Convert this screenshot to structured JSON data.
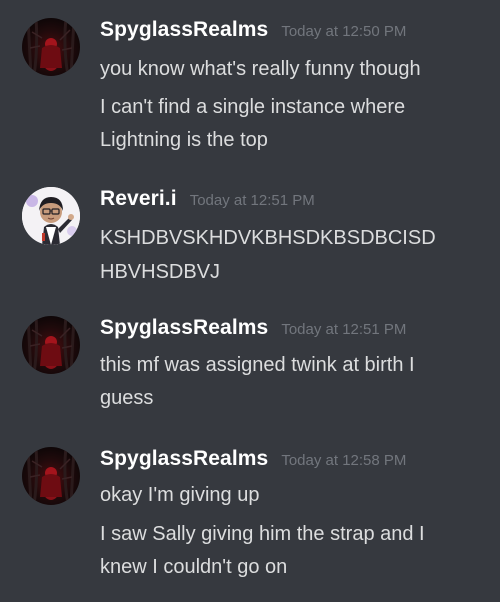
{
  "messages": [
    {
      "author": "SpyglassRealms",
      "timestamp": "Today at 12:50 PM",
      "avatar_icon": "dark-red-forest-avatar-icon",
      "lines": [
        "you know what's really funny though",
        "I can't find a single instance where",
        "Lightning is the top"
      ]
    },
    {
      "author": "Reveri.i",
      "timestamp": "Today at 12:51 PM",
      "avatar_icon": "chibi-character-avatar-icon",
      "lines": [
        "KSHDBVSKHDVKBHSDKBSDBCISD",
        "HBVHSDBVJ"
      ]
    },
    {
      "author": "SpyglassRealms",
      "timestamp": "Today at 12:51 PM",
      "avatar_icon": "dark-red-forest-avatar-icon",
      "lines": [
        "this mf was assigned twink at birth I",
        "guess"
      ]
    },
    {
      "author": "SpyglassRealms",
      "timestamp": "Today at 12:58 PM",
      "avatar_icon": "dark-red-forest-avatar-icon",
      "lines": [
        "okay I'm giving up",
        "I saw Sally giving him the strap and I",
        "knew I couldn't go on"
      ]
    }
  ],
  "colors": {
    "background": "#36393f",
    "username": "#ffffff",
    "timestamp": "#72767d",
    "message_text": "#dcddde"
  }
}
